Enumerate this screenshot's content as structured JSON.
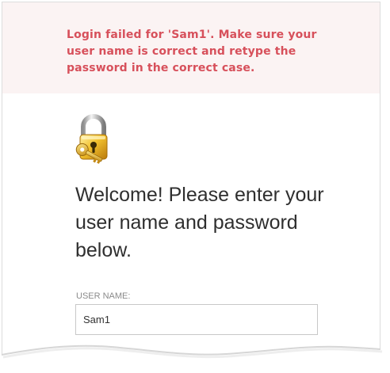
{
  "error": {
    "message": "Login failed for 'Sam1'. Make sure your user name is correct and retype the password in the correct case."
  },
  "icons": {
    "lock": "lock-and-key-icon"
  },
  "welcome": {
    "heading": "Welcome! Please enter your user name and password below."
  },
  "username": {
    "label": "USER NAME:",
    "value": "Sam1"
  },
  "colors": {
    "error_text": "#d7505b",
    "error_background": "#fbf3f3",
    "input_border": "#c8c8c8"
  }
}
